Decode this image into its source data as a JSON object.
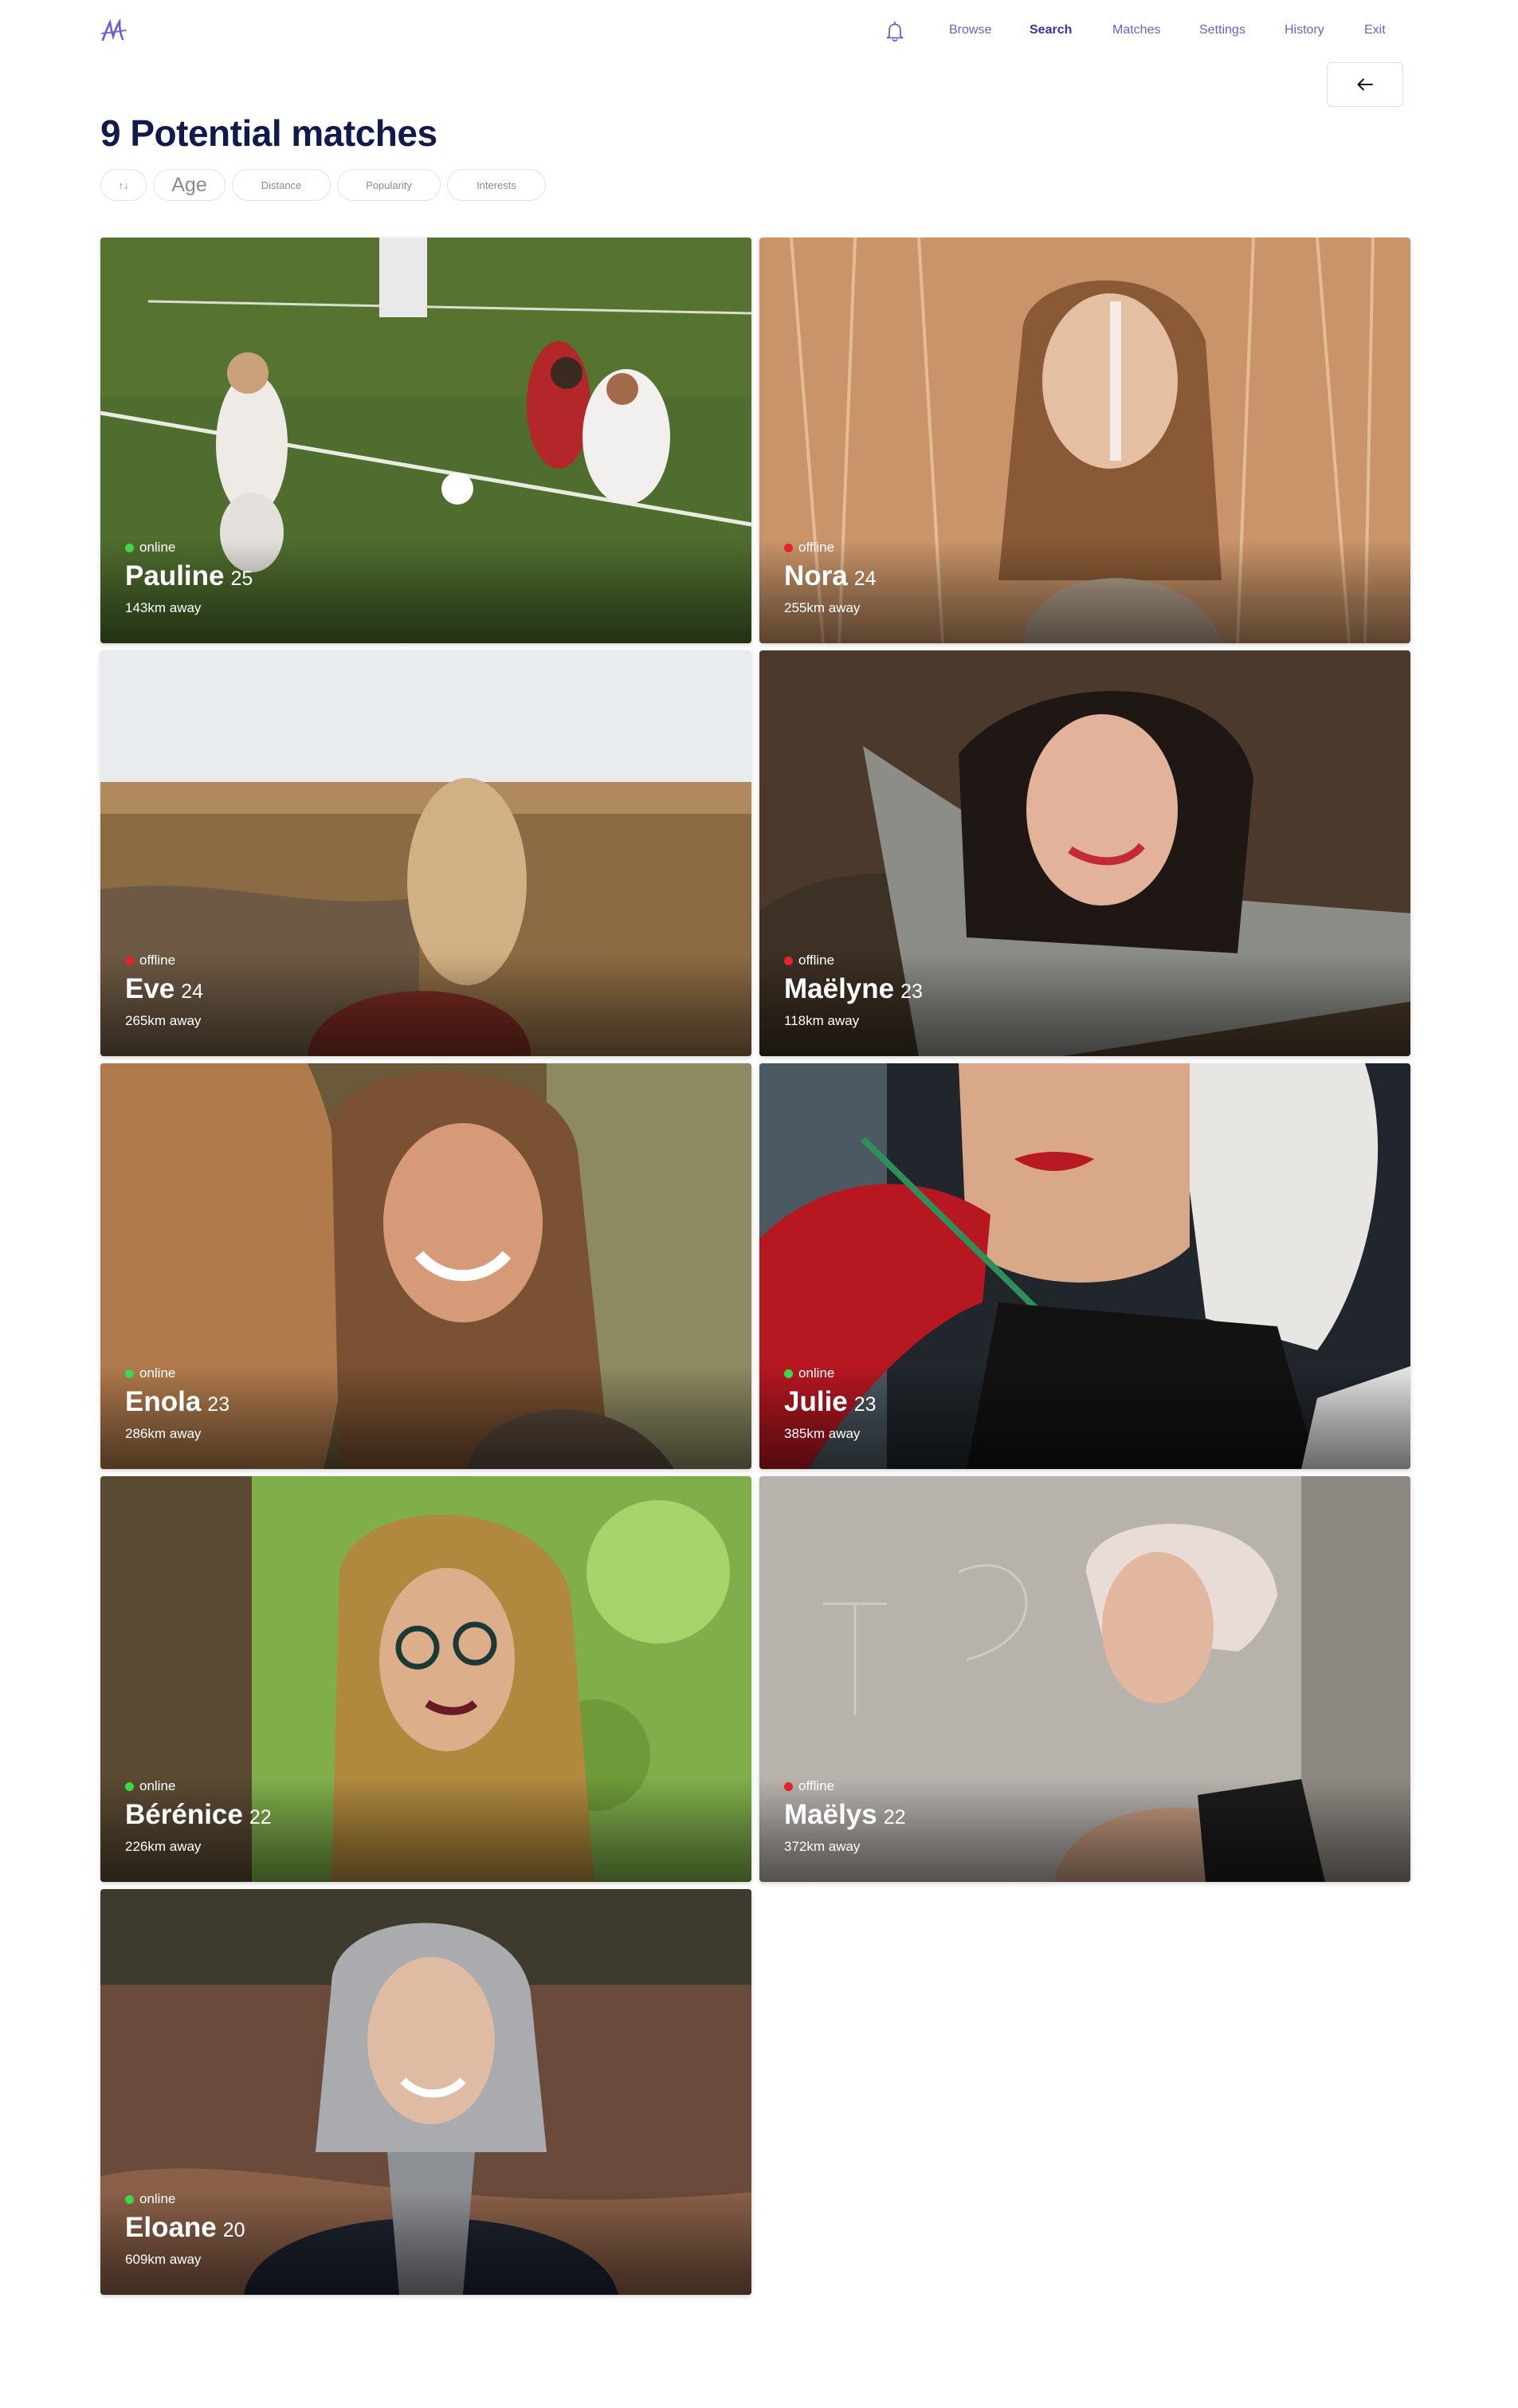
{
  "nav": {
    "links": [
      {
        "label": "Browse"
      },
      {
        "label": "Search"
      },
      {
        "label": "Matches"
      },
      {
        "label": "Settings"
      },
      {
        "label": "History"
      },
      {
        "label": "Exit"
      }
    ],
    "active": "Search",
    "accent_color": "#6b5fd3"
  },
  "header": {
    "title": "9 Potential matches",
    "back_icon": "arrow-left-icon"
  },
  "filters": {
    "sort_icon": "↑↓",
    "chips": [
      {
        "label": "Age"
      },
      {
        "label": "Distance"
      },
      {
        "label": "Popularity"
      },
      {
        "label": "Interests"
      }
    ]
  },
  "status_colors": {
    "online": "#3bd84a",
    "offline": "#e7222c"
  },
  "profiles": [
    {
      "name": "Pauline",
      "age": "25",
      "status": "online",
      "distance": "143km away"
    },
    {
      "name": "Nora",
      "age": "24",
      "status": "offline",
      "distance": "255km away"
    },
    {
      "name": "Eve",
      "age": "24",
      "status": "offline",
      "distance": "265km away"
    },
    {
      "name": "Maëlyne",
      "age": "23",
      "status": "offline",
      "distance": "118km away"
    },
    {
      "name": "Enola",
      "age": "23",
      "status": "online",
      "distance": "286km away"
    },
    {
      "name": "Julie",
      "age": "23",
      "status": "online",
      "distance": "385km away"
    },
    {
      "name": "Bérénice",
      "age": "22",
      "status": "online",
      "distance": "226km away"
    },
    {
      "name": "Maëlys",
      "age": "22",
      "status": "offline",
      "distance": "372km away"
    },
    {
      "name": "Eloane",
      "age": "20",
      "status": "online",
      "distance": "609km away"
    }
  ]
}
